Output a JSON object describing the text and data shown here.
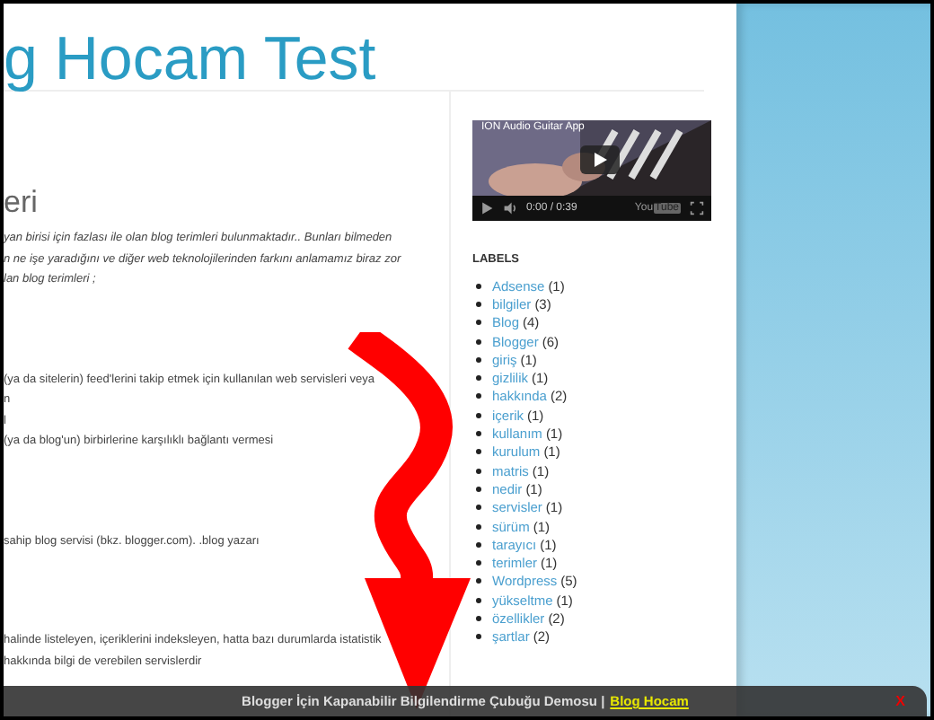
{
  "blog_title": "g Hocam Test",
  "post": {
    "heading": "eri",
    "paragraphs": [
      {
        "italic": true,
        "lines": [
          "yan birisi için fazlası ile olan blog terimleri bulunmaktadır.. Bunları bilmeden",
          "n ne işe yaradığını ve diğer web teknolojilerinden farkını anlamamız biraz zor",
          "lan blog terimleri ;"
        ]
      },
      {
        "italic": false,
        "lines": [
          "(ya da sitelerin) feed'lerini takip etmek için kullanılan web servisleri veya",
          "n",
          "l",
          "(ya da blog'un) birbirlerine karşılıklı bağlantı vermesi"
        ]
      },
      {
        "italic": false,
        "lines": [
          "sahip blog servisi (bkz. blogger.com). .blog yazarı"
        ]
      },
      {
        "italic": false,
        "lines": [
          "halinde listeleyen, içeriklerini indeksleyen, hatta bazı durumlarda istatistik",
          "hakkında bilgi de verebilen servislerdir"
        ]
      }
    ]
  },
  "video": {
    "title": "ION Audio Guitar App",
    "time": "0:00 / 0:39",
    "logo_you": "You",
    "logo_tube": "Tube"
  },
  "labels": {
    "heading": "LABELS",
    "items": [
      {
        "name": "Adsense",
        "count": "(1)"
      },
      {
        "name": "bilgiler",
        "count": "(3)"
      },
      {
        "name": "Blog",
        "count": "(4)"
      },
      {
        "name": "Blogger",
        "count": "(6)"
      },
      {
        "name": "giriş",
        "count": "(1)"
      },
      {
        "name": "gizlilik",
        "count": "(1)"
      },
      {
        "name": "hakkında",
        "count": "(2)"
      },
      {
        "name": "içerik",
        "count": "(1)"
      },
      {
        "name": "kullanım",
        "count": "(1)"
      },
      {
        "name": "kurulum",
        "count": "(1)"
      },
      {
        "name": "matris",
        "count": "(1)"
      },
      {
        "name": "nedir",
        "count": "(1)"
      },
      {
        "name": "servisler",
        "count": "(1)"
      },
      {
        "name": "sürüm",
        "count": "(1)"
      },
      {
        "name": "tarayıcı",
        "count": "(1)"
      },
      {
        "name": "terimler",
        "count": "(1)"
      },
      {
        "name": "Wordpress",
        "count": "(5)"
      },
      {
        "name": "yükseltme",
        "count": "(1)"
      },
      {
        "name": "özellikler",
        "count": "(2)"
      },
      {
        "name": "şartlar",
        "count": "(2)"
      }
    ]
  },
  "info_bar": {
    "text": "Blogger İçin Kapanabilir Bilgilendirme Çubuğu Demosu |",
    "link": "Blog Hocam",
    "close": "X"
  }
}
